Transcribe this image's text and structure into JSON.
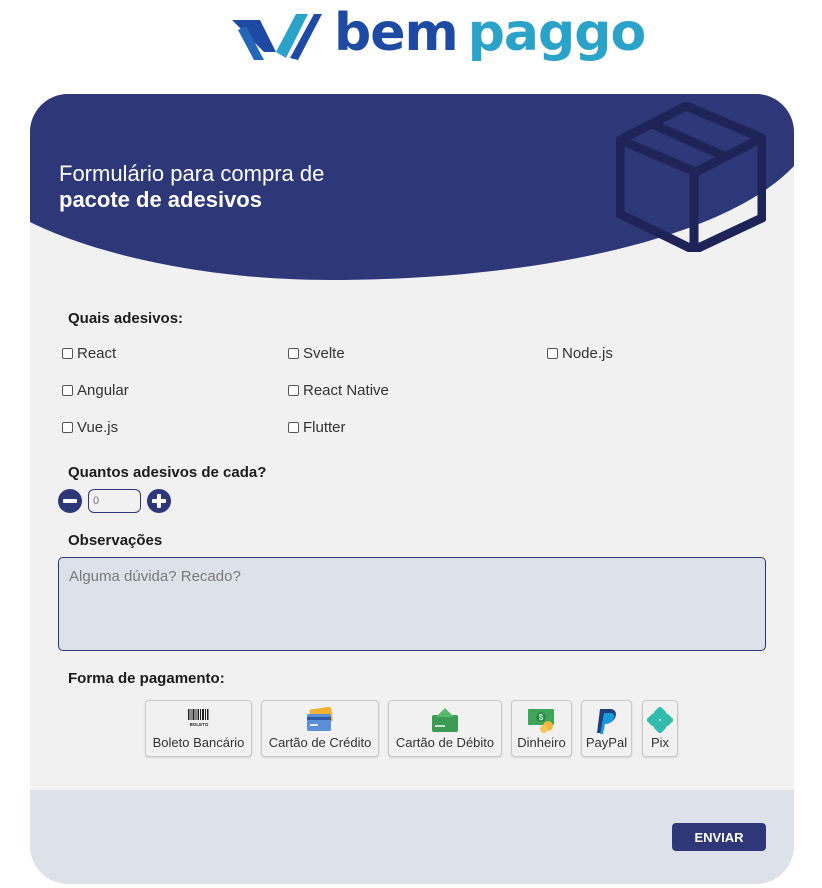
{
  "brand": {
    "part1": "bem",
    "part2": "paggo"
  },
  "header": {
    "title_line1": "Formulário para compra de",
    "title_line2": "pacote de adesivos"
  },
  "stickers": {
    "label": "Quais adesivos:",
    "options": [
      "React",
      "Svelte",
      "Node.js",
      "Angular",
      "React Native",
      "Vue.js",
      "Flutter"
    ]
  },
  "quantity": {
    "label": "Quantos adesivos de cada?",
    "value": "0"
  },
  "notes": {
    "label": "Observações",
    "placeholder": "Alguma dúvida? Recado?"
  },
  "payment": {
    "label": "Forma de pagamento:",
    "methods": [
      "Boleto Bancário",
      "Cartão de Crédito",
      "Cartão de Débito",
      "Dinheiro",
      "PayPal",
      "Pix"
    ],
    "boleto_icon_text": "BOLETO"
  },
  "submit": {
    "label": "ENVIAR"
  },
  "colors": {
    "primary": "#2e3777",
    "brand_blue": "#1f4aa3",
    "brand_cyan": "#2ba3c9",
    "card_bg": "#f1f1f1",
    "footer_bg": "#dde1ea"
  }
}
